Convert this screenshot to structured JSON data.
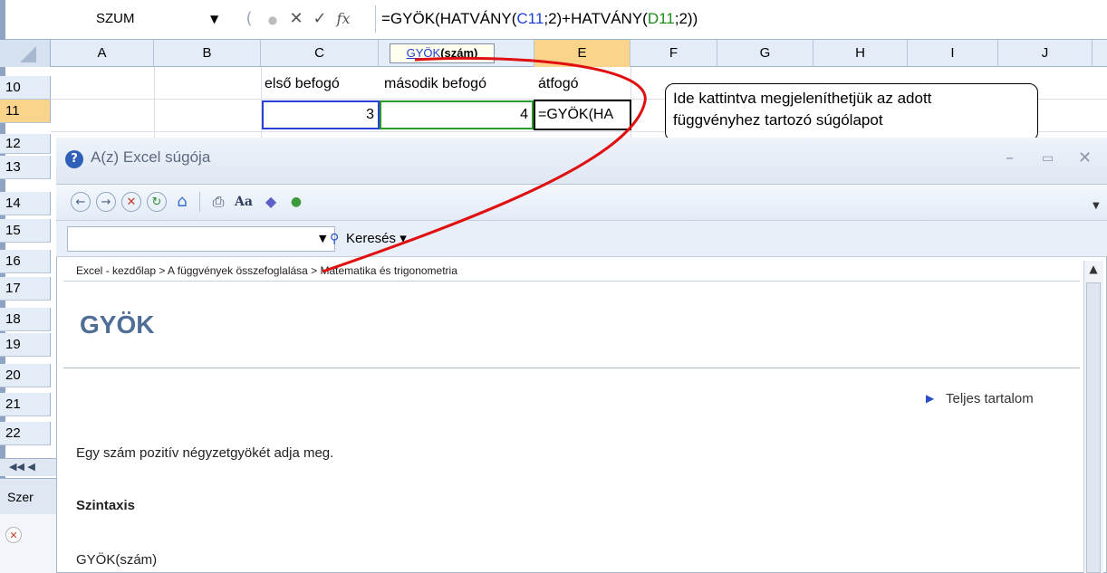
{
  "formula_bar": {
    "name_box": "SZUM",
    "formula_prefix": "=GYÖK(HATVÁNY(",
    "ref1": "C11",
    "formula_mid": ";2)+HATVÁNY(",
    "ref2": "D11",
    "formula_suffix": ";2))"
  },
  "columns": [
    "A",
    "B",
    "C",
    "E",
    "F",
    "G",
    "H",
    "I",
    "J"
  ],
  "rows": [
    "10",
    "11",
    "12",
    "13",
    "14",
    "15",
    "16",
    "17",
    "18",
    "19",
    "20",
    "21",
    "22"
  ],
  "cells": {
    "c10": "első befogó",
    "d10": "második befogó",
    "e10": "átfogó",
    "c11": "3",
    "d11": "4",
    "e11": "=GYÖK(HA"
  },
  "tooltip": {
    "fn": "GYÖK",
    "arg": "(szám)"
  },
  "callout": {
    "line1": "Ide kattintva megjeleníthetjük az adott",
    "line2": "függvényhez tartozó súgólapot"
  },
  "help": {
    "title": "A(z) Excel súgója",
    "search_button": "Keresés",
    "breadcrumb": "Excel - kezdőlap > A függvények összefoglalása > Matematika és trigonometria",
    "heading": "GYÖK",
    "full_contents": "Teljes tartalom",
    "description": "Egy szám pozitív négyzetgyökét adja meg.",
    "syntax_heading": "Szintaxis",
    "syntax": "GYÖK(szám)"
  },
  "sheet_tab": "Szer",
  "colors": {
    "ref1": "#1f3fcf",
    "ref2": "#1d8a1d",
    "annotation": "#e01010",
    "heading": "#4f6e96"
  }
}
